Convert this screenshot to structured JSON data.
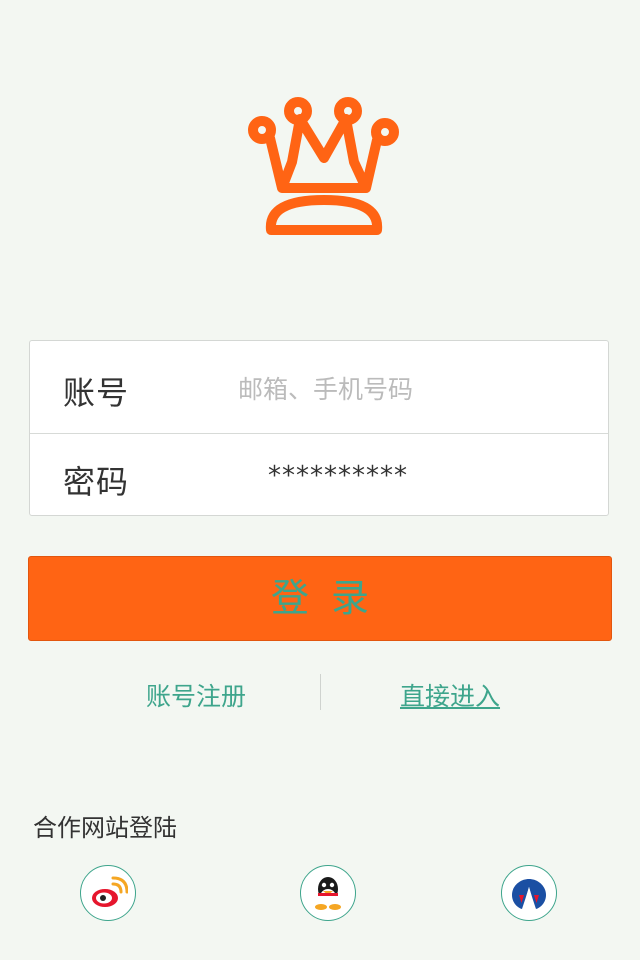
{
  "brand": {
    "logo_icon": "crown-icon",
    "accent_color": "#ff6414",
    "link_color": "#3ea58c"
  },
  "login_form": {
    "account": {
      "label": "账号",
      "placeholder": "邮箱、手机号码",
      "value": ""
    },
    "password": {
      "label": "密码",
      "value": "**********"
    }
  },
  "login_button": {
    "label": "登录"
  },
  "links": {
    "register": "账号注册",
    "direct_enter": "直接进入"
  },
  "partners": {
    "title": "合作网站登陆",
    "items": [
      {
        "icon": "weibo-icon"
      },
      {
        "icon": "qq-icon"
      },
      {
        "icon": "renren-icon"
      }
    ]
  }
}
